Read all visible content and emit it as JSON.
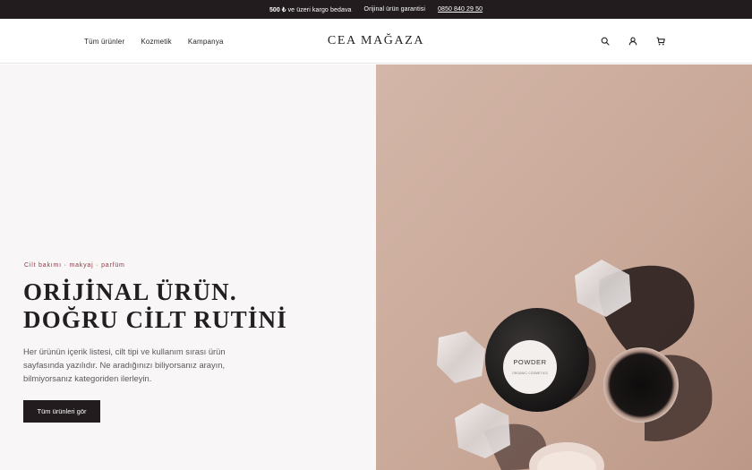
{
  "announcement": {
    "shipping_bold": "500 ₺",
    "shipping_rest": "ve üzeri kargo bedava",
    "guarantee": "Orijinal ürün garantisi",
    "phone": "0850 840 29 50"
  },
  "header": {
    "logo": "CEA MAĞAZA",
    "nav": [
      "Tüm ürünler",
      "Kozmetik",
      "Kampanya"
    ],
    "icons": [
      "search-icon",
      "user-icon",
      "cart-icon"
    ]
  },
  "hero": {
    "eyebrow": "Cilt bakımı · makyaj · parfüm",
    "headline_line1": "ORİJİNAL ÜRÜN.",
    "headline_line2": "DOĞRU CİLT RUTİNİ",
    "body": "Her ürünün içerik listesi, cilt tipi ve kullanım sırası ürün sayfasında yazılıdır. Ne aradığınızı biliyorsanız arayın, bilmiyorsanız kategoriden ilerleyin.",
    "cta_label": "Tüm ürünleri gör",
    "image": {
      "jar_label": "POWDER",
      "jar_sublabel": "ORGANIC COSMETICS",
      "colors": {
        "background": "#c9aa9a",
        "jar_lid": "#222020",
        "jar_label": "#f3efec"
      }
    }
  }
}
